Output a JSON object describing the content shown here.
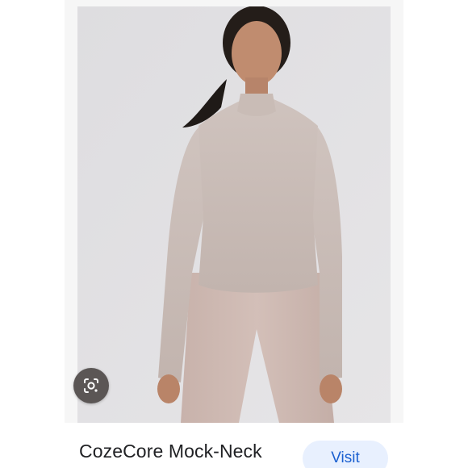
{
  "product": {
    "title": "CozeCore Mock-Neck",
    "image_alt": "Woman wearing a light taupe mock-neck long-sleeve top and matching leggings"
  },
  "actions": {
    "visit_label": "Visit",
    "lens_icon": "google-lens-icon"
  },
  "colors": {
    "background": "#f6f6f6",
    "photo_backdrop": "#e0e0e2",
    "garment": "#cbbeb9",
    "visit_button_bg": "#e8f0fe",
    "visit_button_text": "#1a5fd0",
    "lens_button_bg": "#5b5655"
  }
}
